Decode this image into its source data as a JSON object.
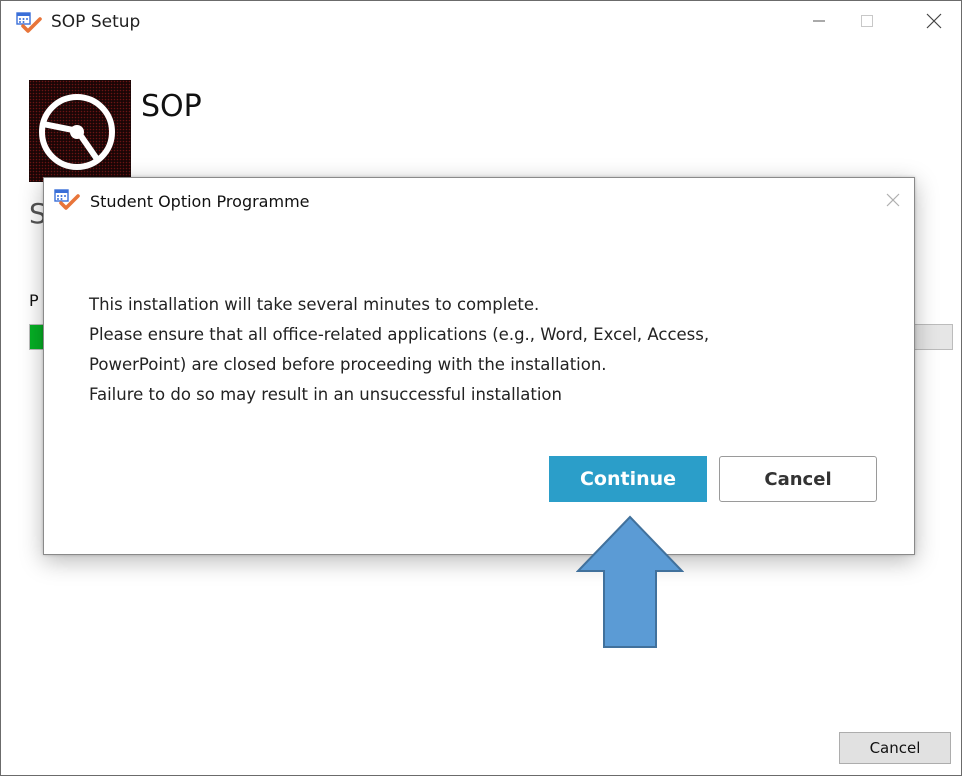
{
  "window": {
    "title": "SOP Setup",
    "app_icon": "installer-icon",
    "controls": [
      "minimize-icon",
      "maximize-icon",
      "close-icon"
    ]
  },
  "header": {
    "product_name": "SOP",
    "logo_icon": "disc-icon"
  },
  "background_partial": {
    "heading_fragment": "S",
    "label_fragment": "P",
    "progress_fraction": 0.02,
    "progress_color": "#06b025"
  },
  "footer": {
    "cancel_label": "Cancel"
  },
  "dialog": {
    "title": "Student Option Programme",
    "icon": "installer-icon",
    "message_lines": [
      "This installation will take several minutes to complete.",
      "Please ensure that all office-related applications (e.g., Word, Excel, Access,",
      "PowerPoint) are closed before proceeding with the installation.",
      "Failure to do so may result in an unsuccessful installation"
    ],
    "continue_label": "Continue",
    "cancel_label": "Cancel",
    "continue_color": "#2b9ec9"
  },
  "annotation": {
    "arrow": "up-arrow-icon",
    "arrow_color": "#5b9bd5"
  }
}
